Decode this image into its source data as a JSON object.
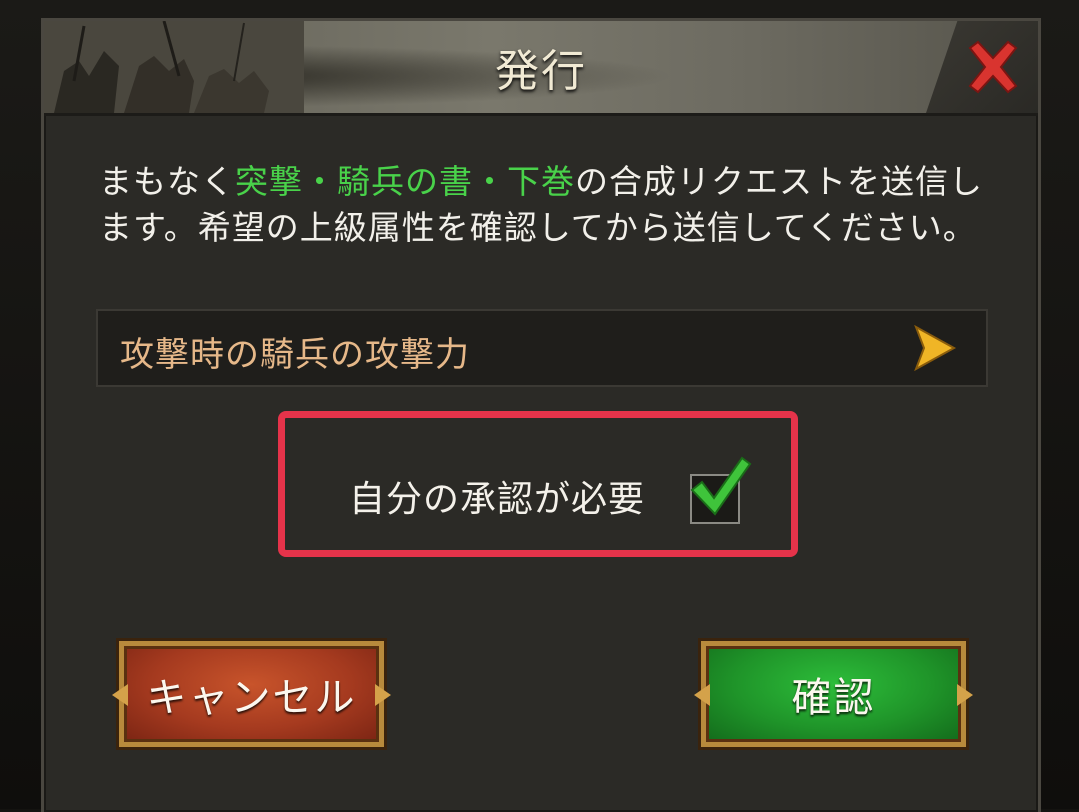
{
  "dialog": {
    "title": "発行",
    "close_icon": "close-icon",
    "message": {
      "prefix": "まもなく",
      "item_name": "突撃・騎兵の書・下巻",
      "suffix": "の合成リクエストを送信します。希望の上級属性を確認してから送信してください。"
    },
    "attribute": {
      "label": "攻撃時の騎兵の攻撃力",
      "icon": "chevron-right-icon"
    },
    "approval": {
      "label": "自分の承認が必要",
      "checked": true,
      "icon": "checkmark-icon"
    },
    "buttons": {
      "cancel_label": "キャンセル",
      "confirm_label": "確認"
    }
  },
  "colors": {
    "highlight_green": "#49d24a",
    "attribute_text": "#e6b889",
    "annotation_red": "#e5334a",
    "close_red": "#d9342f"
  }
}
